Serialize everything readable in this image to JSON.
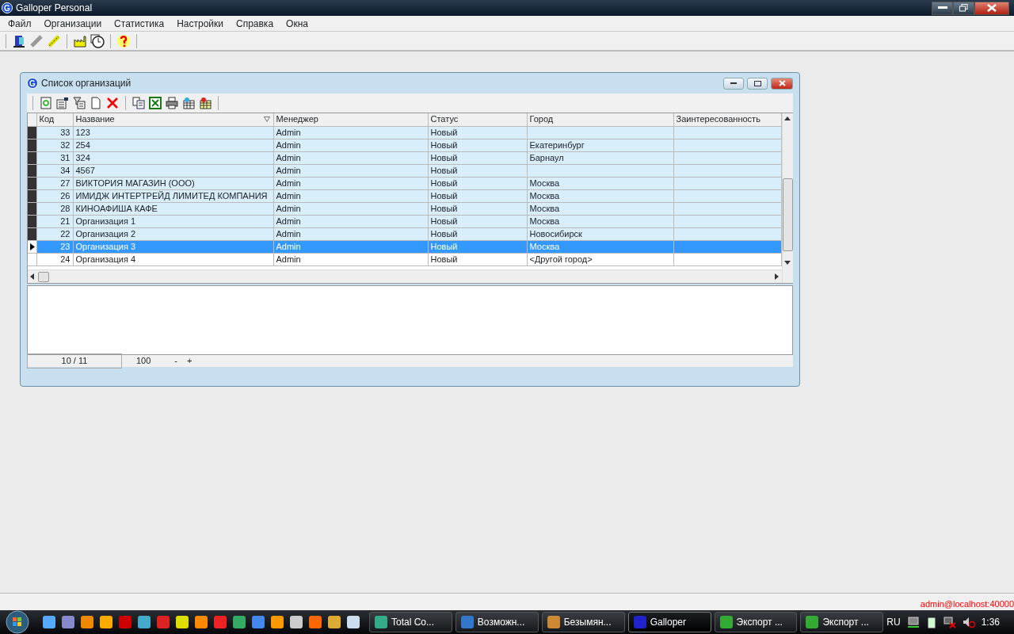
{
  "window": {
    "logo": "G",
    "title": "Galloper Personal"
  },
  "menu": [
    "Файл",
    "Организации",
    "Статистика",
    "Настройки",
    "Справка",
    "Окна"
  ],
  "child_window": {
    "logo": "G",
    "title": "Список организаций",
    "columns": [
      "Код",
      "Название",
      "Менеджер",
      "Статус",
      "Город",
      "Заинтересованность"
    ],
    "rows": [
      {
        "cells": [
          "33",
          "123",
          "Admin",
          "Новый",
          "",
          ""
        ],
        "marked": true,
        "selected": false
      },
      {
        "cells": [
          "32",
          "254",
          "Admin",
          "Новый",
          "Екатеринбург",
          ""
        ],
        "marked": true,
        "selected": false
      },
      {
        "cells": [
          "31",
          "324",
          "Admin",
          "Новый",
          "Барнаул",
          ""
        ],
        "marked": true,
        "selected": false
      },
      {
        "cells": [
          "34",
          "4567",
          "Admin",
          "Новый",
          "",
          ""
        ],
        "marked": true,
        "selected": false
      },
      {
        "cells": [
          "27",
          "ВИКТОРИЯ МАГАЗИН (ООО)",
          "Admin",
          "Новый",
          "Москва",
          ""
        ],
        "marked": true,
        "selected": false
      },
      {
        "cells": [
          "26",
          "ИМИДЖ ИНТЕРТРЕЙД ЛИМИТЕД КОМПАНИЯ",
          "Admin",
          "Новый",
          "Москва",
          ""
        ],
        "marked": true,
        "selected": false
      },
      {
        "cells": [
          "28",
          "КИНОАФИША КАФЕ",
          "Admin",
          "Новый",
          "Москва",
          ""
        ],
        "marked": true,
        "selected": false
      },
      {
        "cells": [
          "21",
          "Организация 1",
          "Admin",
          "Новый",
          "Москва",
          ""
        ],
        "marked": true,
        "selected": false
      },
      {
        "cells": [
          "22",
          "Организация 2",
          "Admin",
          "Новый",
          "Новосибирск",
          ""
        ],
        "marked": true,
        "selected": false
      },
      {
        "cells": [
          "23",
          "Организация 3",
          "Admin",
          "Новый",
          "Москва",
          ""
        ],
        "marked": false,
        "selected": true
      },
      {
        "cells": [
          "24",
          "Организация 4",
          "Admin",
          "Новый",
          "<Другой город>",
          ""
        ],
        "marked": false,
        "selected": false
      }
    ],
    "footer": {
      "position": "10 / 11",
      "page_size": "100",
      "minus": "-",
      "plus": "+"
    }
  },
  "status_bar": {
    "connection": "admin@localhost:40000"
  },
  "taskbar": {
    "tasks": [
      {
        "label": "Total Co...",
        "active": false
      },
      {
        "label": "Возможн...",
        "active": false
      },
      {
        "label": "Безымян...",
        "active": false
      },
      {
        "label": "Galloper",
        "active": true
      },
      {
        "label": "Экспорт ...",
        "active": false
      },
      {
        "label": "Экспорт ...",
        "active": false
      }
    ],
    "language": "RU",
    "clock": "1:36"
  }
}
